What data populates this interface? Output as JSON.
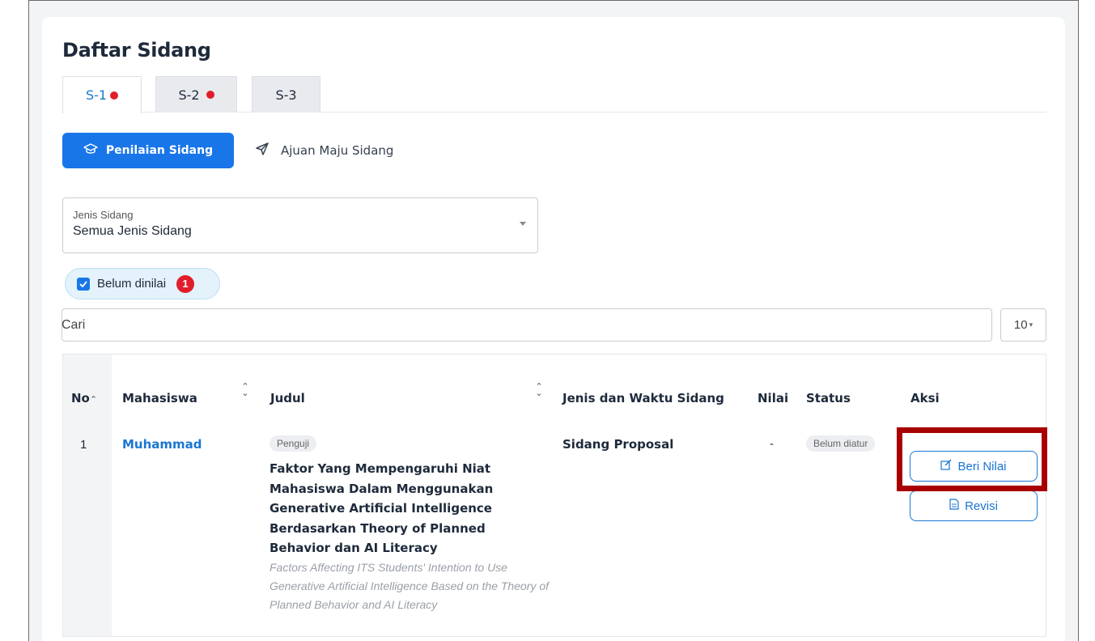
{
  "page": {
    "title": "Daftar Sidang"
  },
  "tabs": [
    {
      "label": "S-1",
      "has_dot": true,
      "active": true
    },
    {
      "label": "S-2",
      "has_dot": true,
      "active": false
    },
    {
      "label": "S-3",
      "has_dot": false,
      "active": false
    }
  ],
  "subnav": {
    "primary_label": "Penilaian Sidang",
    "primary_icon": "graduation-cap-icon",
    "link_label": "Ajuan Maju Sidang",
    "link_icon": "paper-plane-icon"
  },
  "filter": {
    "select_label": "Jenis Sidang",
    "select_value": "Semua Jenis Sidang",
    "chip_label": "Belum dinilai",
    "chip_count": "1",
    "chip_checked": true
  },
  "search": {
    "placeholder": "Cari",
    "per_page": "10"
  },
  "table": {
    "headers": [
      "No",
      "Mahasiswa",
      "Judul",
      "Jenis dan Waktu Sidang",
      "Nilai",
      "Status",
      "Aksi"
    ],
    "rows": [
      {
        "no": "1",
        "mahasiswa": "Muhammad",
        "role": "Penguji",
        "judul": "Faktor Yang Mempengaruhi Niat Mahasiswa Dalam Menggunakan Generative Artificial Intelligence Berdasarkan Theory of Planned Behavior dan AI Literacy",
        "judul_en": "Factors Affecting ITS Students' Intention to Use Generative Artificial Intelligence Based on the Theory of Planned Behavior and AI Literacy",
        "jenis": "Sidang Proposal",
        "nilai": "-",
        "status": "Belum diatur",
        "actions": {
          "grade_label": "Beri Nilai",
          "revision_label": "Revisi"
        }
      }
    ]
  },
  "colors": {
    "primary": "#1976e8",
    "alert": "#e11d2a",
    "highlight": "#a80000"
  }
}
